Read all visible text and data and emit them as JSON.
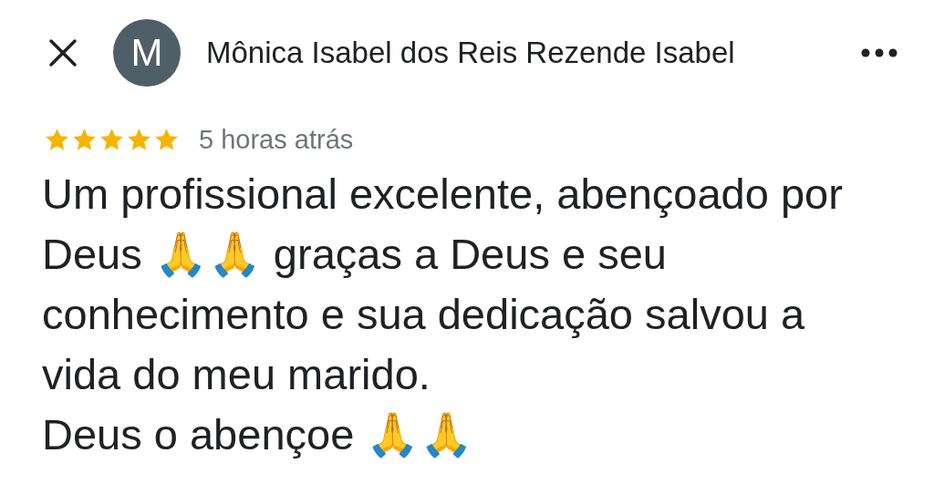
{
  "header": {
    "avatar_letter": "M",
    "author": "Mônica Isabel dos Reis Rezende Isabel"
  },
  "review": {
    "stars": 5,
    "time": "5 horas atrás",
    "paragraphs": [
      "Um profissional excelente, abençoado por Deus 🙏🙏 graças a Deus e seu conhecimento e sua dedicação salvou a vida do meu marido.",
      "Deus o abençoe 🙏🙏"
    ]
  }
}
